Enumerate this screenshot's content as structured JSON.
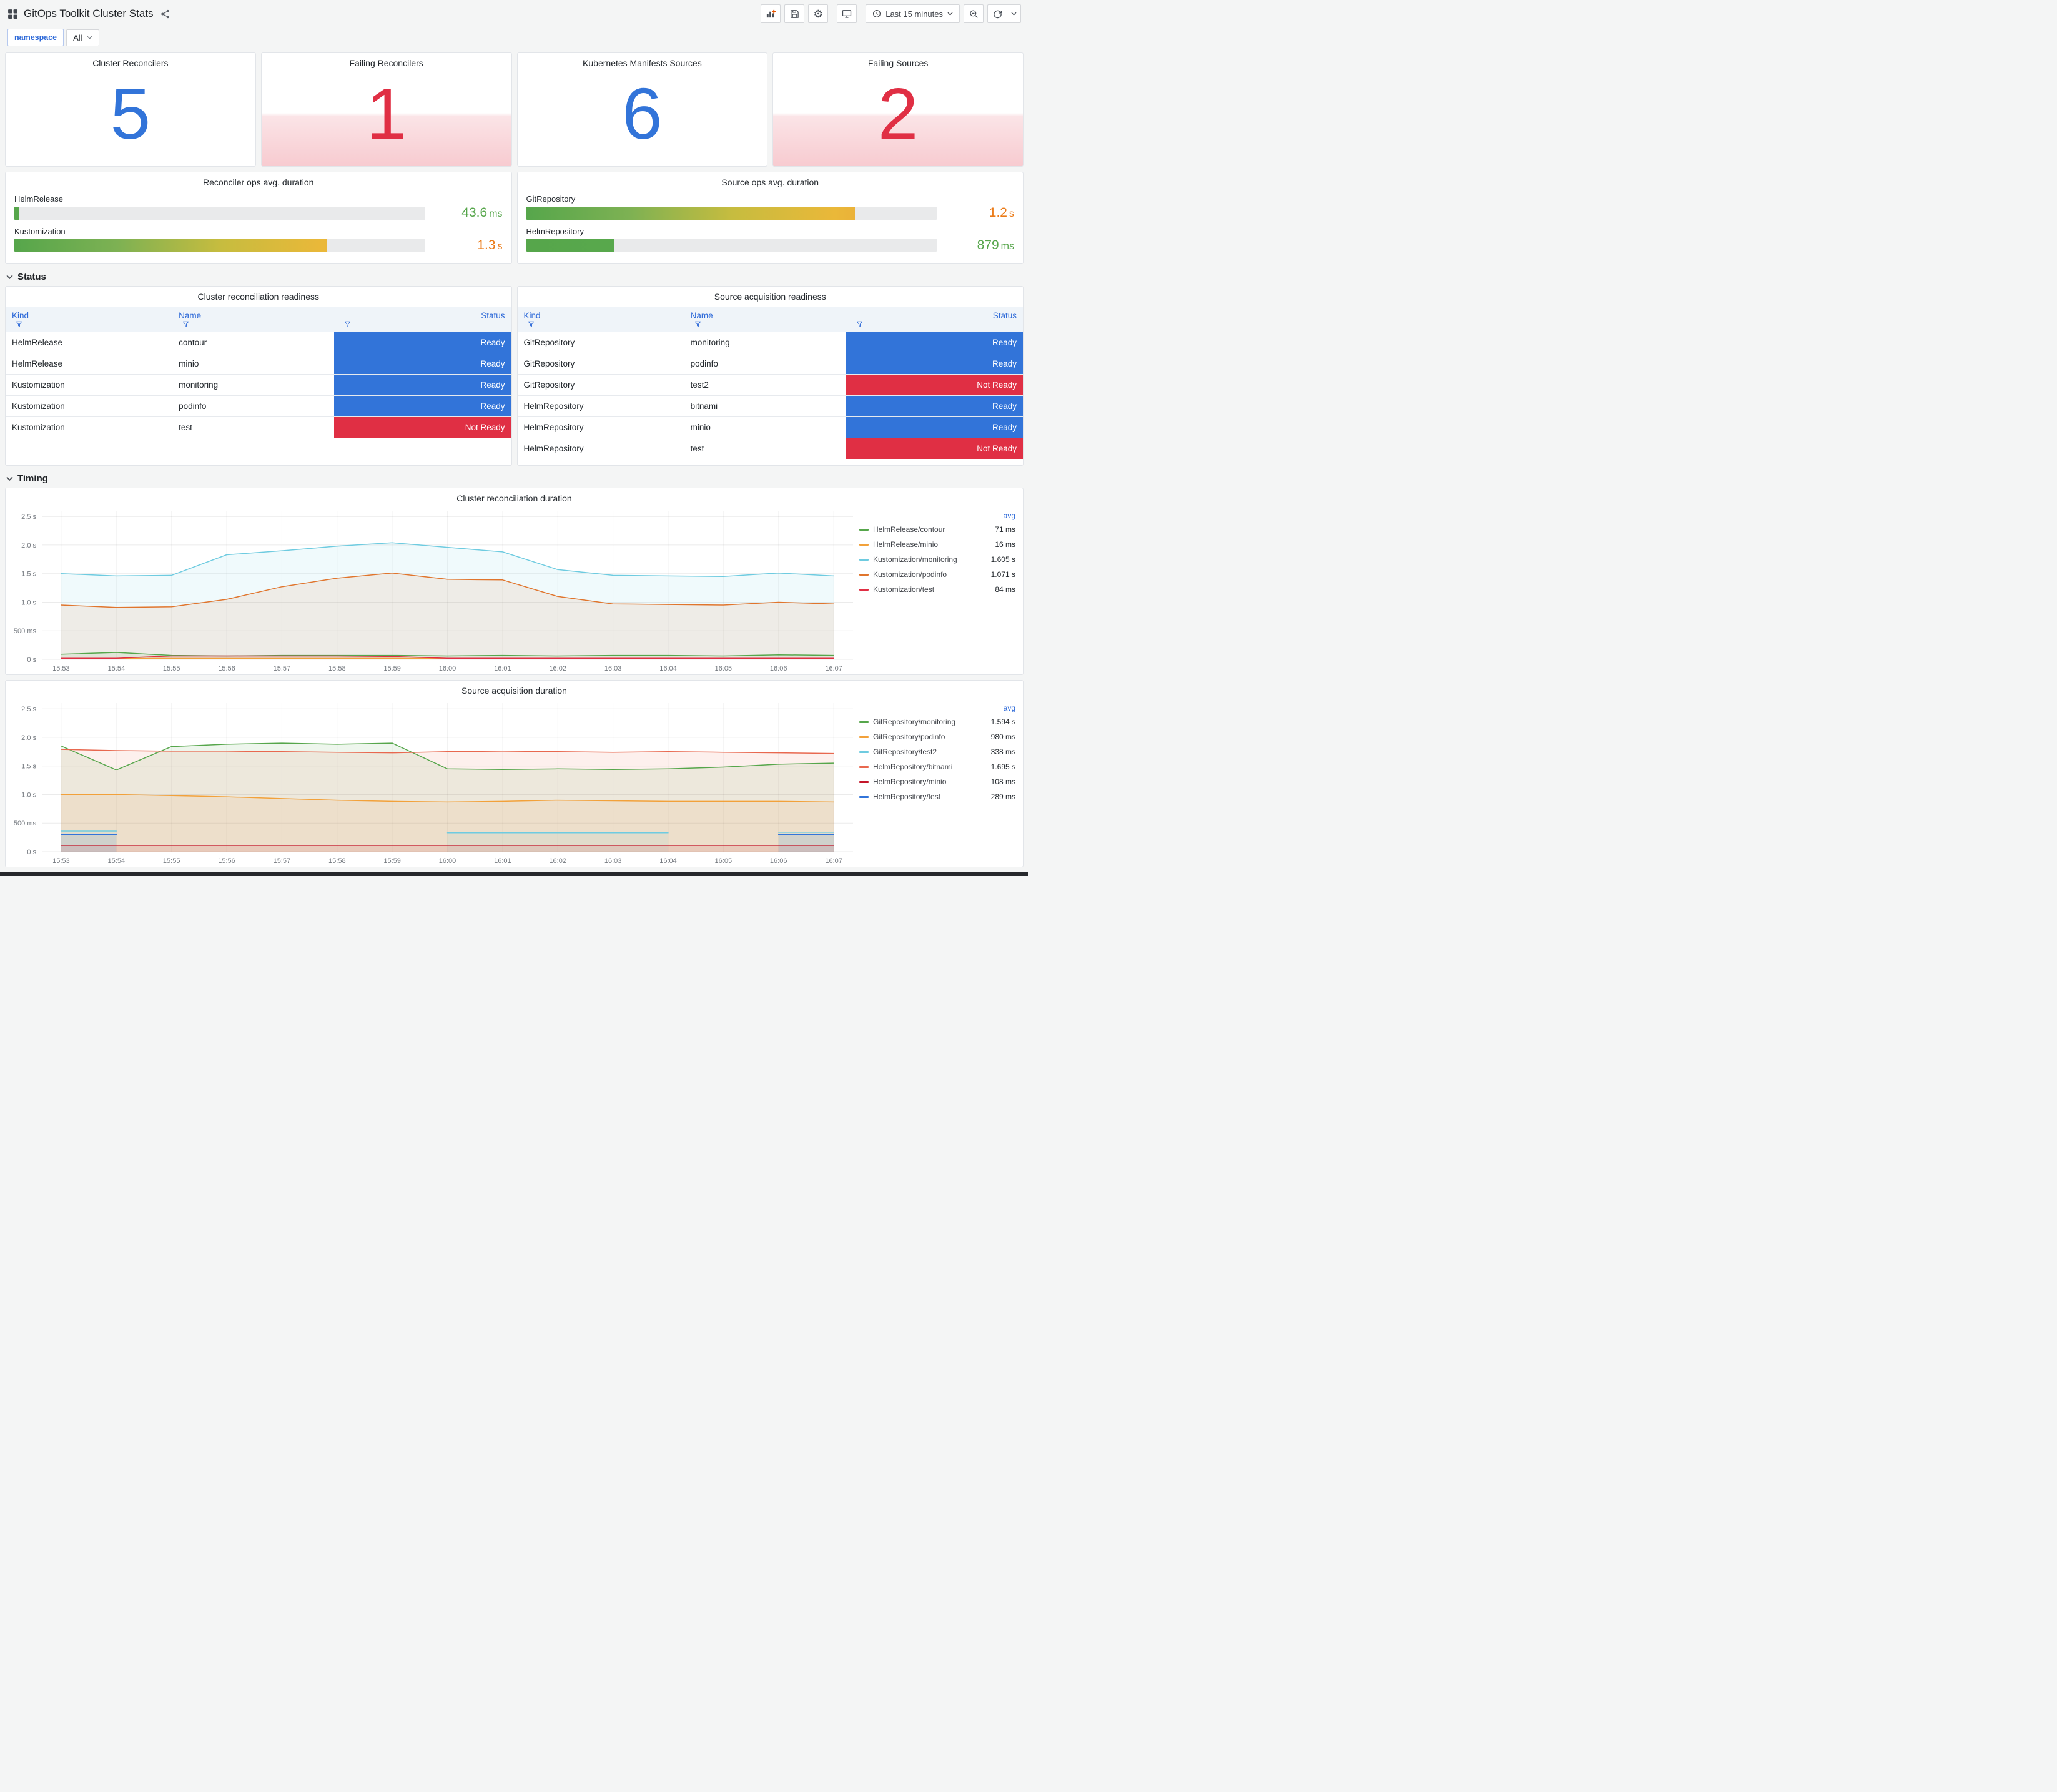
{
  "header": {
    "title": "GitOps Toolkit Cluster Stats",
    "time_picker": "Last 15 minutes"
  },
  "icons": {
    "gear": "⚙"
  },
  "variables": {
    "label": "namespace",
    "value": "All"
  },
  "stat_panels": [
    {
      "title": "Cluster Reconcilers",
      "value": "5",
      "color": "#3274D9",
      "alert": false
    },
    {
      "title": "Failing Reconcilers",
      "value": "1",
      "color": "#E02F44",
      "alert": true
    },
    {
      "title": "Kubernetes Manifests Sources",
      "value": "6",
      "color": "#3274D9",
      "alert": false
    },
    {
      "title": "Failing Sources",
      "value": "2",
      "color": "#E02F44",
      "alert": true
    }
  ],
  "gauge_panels": [
    {
      "title": "Reconciler ops avg. duration",
      "rows": [
        {
          "label": "HelmRelease",
          "value": "43.6",
          "unit": "ms",
          "pct": 1.2,
          "value_color": "#56A64B",
          "bar_colors": [
            "#56A64B",
            "#5BAD4E"
          ]
        },
        {
          "label": "Kustomization",
          "value": "1.3",
          "unit": "s",
          "pct": 76,
          "value_color": "#EB7B18",
          "bar_colors": [
            "#56A64B",
            "#7DB153",
            "#C6BC3F",
            "#EAB839",
            "#EE9B3A"
          ]
        }
      ]
    },
    {
      "title": "Source ops avg. duration",
      "rows": [
        {
          "label": "GitRepository",
          "value": "1.2",
          "unit": "s",
          "pct": 80,
          "value_color": "#EB7B18",
          "bar_colors": [
            "#56A64B",
            "#7DB153",
            "#C6BC3F",
            "#EAB839",
            "#EE9B3A"
          ]
        },
        {
          "label": "HelmRepository",
          "value": "879",
          "unit": "ms",
          "pct": 21.5,
          "value_color": "#56A64B",
          "bar_colors": [
            "#56A64B",
            "#60B04F"
          ]
        }
      ]
    }
  ],
  "sections": [
    {
      "label": "Status"
    },
    {
      "label": "Timing"
    }
  ],
  "status_colors": {
    "ready": "#3274D9",
    "not_ready": "#E02F44"
  },
  "table_panels": [
    {
      "title": "Cluster reconciliation readiness",
      "columns": [
        "Kind",
        "Name",
        "Status"
      ],
      "rows": [
        {
          "kind": "HelmRelease",
          "name": "contour",
          "status": "Ready"
        },
        {
          "kind": "HelmRelease",
          "name": "minio",
          "status": "Ready"
        },
        {
          "kind": "Kustomization",
          "name": "monitoring",
          "status": "Ready"
        },
        {
          "kind": "Kustomization",
          "name": "podinfo",
          "status": "Ready"
        },
        {
          "kind": "Kustomization",
          "name": "test",
          "status": "Not Ready"
        }
      ]
    },
    {
      "title": "Source acquisition readiness",
      "columns": [
        "Kind",
        "Name",
        "Status"
      ],
      "rows": [
        {
          "kind": "GitRepository",
          "name": "monitoring",
          "status": "Ready"
        },
        {
          "kind": "GitRepository",
          "name": "podinfo",
          "status": "Ready"
        },
        {
          "kind": "GitRepository",
          "name": "test2",
          "status": "Not Ready"
        },
        {
          "kind": "HelmRepository",
          "name": "bitnami",
          "status": "Ready"
        },
        {
          "kind": "HelmRepository",
          "name": "minio",
          "status": "Ready"
        },
        {
          "kind": "HelmRepository",
          "name": "test",
          "status": "Not Ready"
        }
      ]
    }
  ],
  "chart_data": [
    {
      "type": "line",
      "title": "Cluster reconciliation duration",
      "legend_header": "avg",
      "legend_position": "right",
      "grid": true,
      "x_ticks": [
        "15:53",
        "15:54",
        "15:55",
        "15:56",
        "15:57",
        "15:58",
        "15:59",
        "16:00",
        "16:01",
        "16:02",
        "16:03",
        "16:04",
        "16:05",
        "16:06",
        "16:07"
      ],
      "y_ticks": [
        "0 s",
        "500 ms",
        "1.0 s",
        "1.5 s",
        "2.0 s",
        "2.5 s"
      ],
      "y_tick_values": [
        0,
        0.5,
        1.0,
        1.5,
        2.0,
        2.5
      ],
      "ylim": [
        0,
        2.6
      ],
      "series": [
        {
          "name": "HelmRelease/contour",
          "color": "#56A64B",
          "avg": "71 ms",
          "values": [
            0.09,
            0.12,
            0.07,
            0.06,
            0.07,
            0.07,
            0.07,
            0.06,
            0.07,
            0.06,
            0.07,
            0.07,
            0.06,
            0.08,
            0.07
          ]
        },
        {
          "name": "HelmRelease/minio",
          "color": "#F2A13A",
          "avg": "16 ms",
          "values": [
            0.016,
            0.016,
            0.016,
            0.016,
            0.016,
            0.016,
            0.016,
            0.016,
            0.016,
            0.016,
            0.016,
            0.016,
            0.016,
            0.016,
            0.016
          ]
        },
        {
          "name": "Kustomization/monitoring",
          "color": "#6ECBE0",
          "avg": "1.605 s",
          "values": [
            1.5,
            1.46,
            1.47,
            1.83,
            1.9,
            1.98,
            2.04,
            1.96,
            1.88,
            1.57,
            1.47,
            1.46,
            1.45,
            1.51,
            1.46
          ]
        },
        {
          "name": "Kustomization/podinfo",
          "color": "#E0752D",
          "avg": "1.071 s",
          "values": [
            0.95,
            0.91,
            0.92,
            1.05,
            1.27,
            1.42,
            1.51,
            1.4,
            1.39,
            1.1,
            0.97,
            0.96,
            0.95,
            1.0,
            0.97
          ]
        },
        {
          "name": "Kustomization/test",
          "color": "#E02F44",
          "avg": "84 ms",
          "values": [
            0.02,
            0.02,
            0.06,
            0.06,
            0.06,
            0.06,
            0.05,
            0.02,
            0.02,
            0.02,
            0.02,
            0.02,
            0.02,
            0.02,
            0.02
          ]
        }
      ]
    },
    {
      "type": "line",
      "title": "Source acquisition duration",
      "legend_header": "avg",
      "legend_position": "right",
      "grid": true,
      "x_ticks": [
        "15:53",
        "15:54",
        "15:55",
        "15:56",
        "15:57",
        "15:58",
        "15:59",
        "16:00",
        "16:01",
        "16:02",
        "16:03",
        "16:04",
        "16:05",
        "16:06",
        "16:07"
      ],
      "y_ticks": [
        "0 s",
        "500 ms",
        "1.0 s",
        "1.5 s",
        "2.0 s",
        "2.5 s"
      ],
      "y_tick_values": [
        0,
        0.5,
        1.0,
        1.5,
        2.0,
        2.5
      ],
      "ylim": [
        0,
        2.6
      ],
      "series": [
        {
          "name": "GitRepository/monitoring",
          "color": "#56A64B",
          "avg": "1.594 s",
          "values": [
            1.85,
            1.43,
            1.84,
            1.88,
            1.9,
            1.88,
            1.9,
            1.45,
            1.44,
            1.45,
            1.44,
            1.45,
            1.48,
            1.53,
            1.55
          ]
        },
        {
          "name": "GitRepository/podinfo",
          "color": "#F2A13A",
          "avg": "980 ms",
          "values": [
            1.0,
            1.0,
            0.98,
            0.96,
            0.93,
            0.9,
            0.88,
            0.87,
            0.88,
            0.9,
            0.89,
            0.88,
            0.88,
            0.88,
            0.87
          ]
        },
        {
          "name": "GitRepository/test2",
          "color": "#6ECBE0",
          "avg": "338 ms",
          "values": [
            0.36,
            0.36,
            null,
            null,
            null,
            null,
            null,
            0.33,
            0.33,
            0.33,
            0.33,
            0.33,
            null,
            0.34,
            0.34
          ]
        },
        {
          "name": "HelmRepository/bitnami",
          "color": "#E8684F",
          "avg": "1.695 s",
          "values": [
            1.79,
            1.77,
            1.76,
            1.76,
            1.75,
            1.74,
            1.73,
            1.75,
            1.76,
            1.75,
            1.74,
            1.75,
            1.74,
            1.73,
            1.72
          ]
        },
        {
          "name": "HelmRepository/minio",
          "color": "#C4162A",
          "avg": "108 ms",
          "values": [
            0.11,
            0.11,
            0.11,
            0.11,
            0.11,
            0.11,
            0.11,
            0.11,
            0.11,
            0.11,
            0.11,
            0.11,
            0.11,
            0.11,
            0.11
          ]
        },
        {
          "name": "HelmRepository/test",
          "color": "#3274D9",
          "avg": "289 ms",
          "values": [
            0.3,
            0.3,
            null,
            null,
            null,
            null,
            null,
            null,
            null,
            null,
            null,
            null,
            null,
            0.3,
            0.3
          ]
        }
      ]
    }
  ]
}
